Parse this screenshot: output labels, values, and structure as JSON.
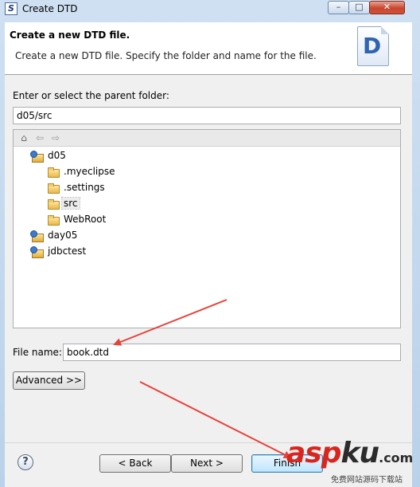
{
  "window": {
    "title": "Create DTD",
    "minimize_label": "–",
    "maximize_label": "□",
    "close_label": "✕"
  },
  "banner": {
    "title": "Create a new DTD file.",
    "description": "Create a new DTD file. Specify the folder and name for the file.",
    "logo_letter": "D"
  },
  "parent_folder": {
    "label": "Enter or select the parent folder:",
    "value": "d05/src"
  },
  "tree_toolbar": {
    "home_icon": "⌂",
    "back_icon": "⇦",
    "forward_icon": "⇨"
  },
  "tree": {
    "items": [
      {
        "label": "d05",
        "icon": "project-icon",
        "level": 0
      },
      {
        "label": ".myeclipse",
        "icon": "folder-icon",
        "level": 1
      },
      {
        "label": ".settings",
        "icon": "folder-icon",
        "level": 1
      },
      {
        "label": "src",
        "icon": "folder-open-icon",
        "level": 1,
        "selected": true
      },
      {
        "label": "WebRoot",
        "icon": "folder-icon",
        "level": 1
      },
      {
        "label": "day05",
        "icon": "project-icon",
        "level": 0
      },
      {
        "label": "jdbctest",
        "icon": "project-icon",
        "level": 0
      }
    ]
  },
  "file_name": {
    "label": "File name:",
    "value": "book.dtd"
  },
  "buttons": {
    "advanced": "Advanced >>",
    "back": "< Back",
    "next": "Next >",
    "finish": "Finish",
    "help": "?"
  },
  "watermark": {
    "brand_a": "a",
    "brand_s": "s",
    "brand_p": "p",
    "brand_k": "k",
    "brand_u": "u",
    "brand_com": ".com",
    "subtitle": "免费网站源码下载站"
  },
  "colors": {
    "annotation_arrow": "#e8423a",
    "brand_red": "#d8261f"
  }
}
